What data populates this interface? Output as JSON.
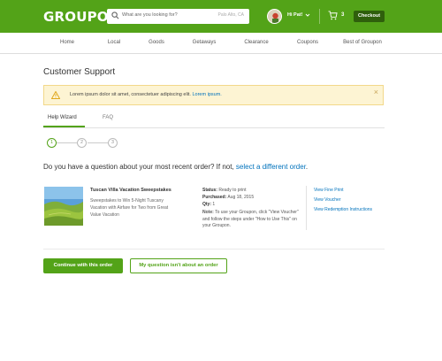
{
  "header": {
    "logo": "GROUPON",
    "search_placeholder": "What are you looking for?",
    "location": "Palo Alto, CA",
    "greeting": "Hi Pat!",
    "cart_count": "3",
    "checkout_label": "Checkout"
  },
  "nav": {
    "items": [
      "Home",
      "Local",
      "Goods",
      "Getaways",
      "Clearance",
      "Coupons",
      "Best of Groupon"
    ]
  },
  "page": {
    "title": "Customer Support"
  },
  "alert": {
    "text": "Lorem ipsum dolor sit amet, consectetuer adipiscing elit. ",
    "link": "Lorem ipsum.",
    "close": "×"
  },
  "tabs": {
    "active": "Help Wizard",
    "faq": "FAQ"
  },
  "steps": [
    "1",
    "2",
    "3"
  ],
  "question": {
    "text": "Do you have a question about your most recent order? If not, ",
    "link": "select a different order",
    "end": "."
  },
  "order": {
    "title": "Tuscan Villa Vacation Sweepstakes",
    "description": "Sweepstakes to Win 5-Night Tuscany Vacation with Airfare for Two from Great Value Vacation",
    "status_label": "Status:",
    "status_value": "Ready to print",
    "purchased_label": "Purchased:",
    "purchased_value": "Aug 18, 2015",
    "qty_label": "Qty:",
    "qty_value": "1",
    "note_label": "Note:",
    "note_text": "To use your Groupon, click \"View Voucher\" and follow the steps under \"How to Use This\" on your Groupon.",
    "links": [
      "View Fine Print",
      "View Voucher",
      "View Redemption Instructions"
    ]
  },
  "buttons": {
    "continue": "Continue with this order",
    "not_about": "My question isn't about an order"
  },
  "colors": {
    "brand_green": "#53a318",
    "link_blue": "#0072bc",
    "alert_bg": "#fdf4d3"
  }
}
